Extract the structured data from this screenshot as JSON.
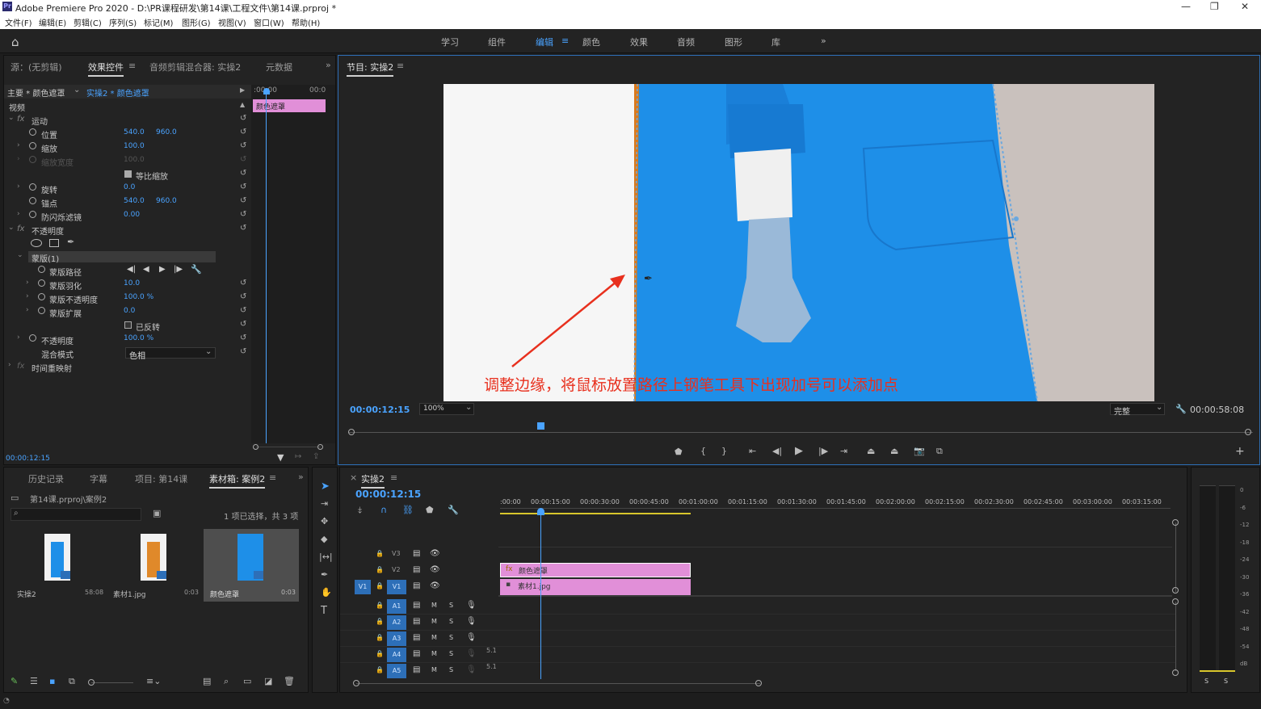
{
  "titlebar": {
    "title": "Adobe Premiere Pro 2020 - D:\\PR课程研发\\第14课\\工程文件\\第14课.prproj *",
    "logo": "Pr"
  },
  "menu": [
    "文件(F)",
    "编辑(E)",
    "剪辑(C)",
    "序列(S)",
    "标记(M)",
    "图形(G)",
    "视图(V)",
    "窗口(W)",
    "帮助(H)"
  ],
  "workspaces": [
    {
      "label": "学习"
    },
    {
      "label": "组件"
    },
    {
      "label": "编辑",
      "active": true
    },
    {
      "label": "颜色"
    },
    {
      "label": "效果"
    },
    {
      "label": "音频"
    },
    {
      "label": "图形"
    },
    {
      "label": "库"
    }
  ],
  "effects_panel": {
    "tabs": [
      "源：(无剪辑)",
      "效果控件",
      "音频剪辑混合器: 实操2",
      "元数据"
    ],
    "header_master": "主要 * 颜色遮罩",
    "header_clip": "实操2 * 颜色遮罩",
    "timecode_start": ":00:00",
    "timecode_end": "00:0",
    "clip_label": "颜色遮罩",
    "section_video": "视频",
    "motion": "运动",
    "position_label": "位置",
    "position_x": "540.0",
    "position_y": "960.0",
    "scale_label": "缩放",
    "scale_value": "100.0",
    "scale_width_label": "缩放宽度",
    "scale_width_value": "100.0",
    "uniform_scale": "等比缩放",
    "rotation_label": "旋转",
    "rotation_value": "0.0",
    "anchor_label": "锚点",
    "anchor_x": "540.0",
    "anchor_y": "960.0",
    "antiflicker_label": "防闪烁滤镜",
    "antiflicker_value": "0.00",
    "opacity_section": "不透明度",
    "mask_label": "蒙版(1)",
    "mask_path_label": "蒙版路径",
    "mask_feather_label": "蒙版羽化",
    "mask_feather_value": "10.0",
    "mask_opacity_label": "蒙版不透明度",
    "mask_opacity_value": "100.0 %",
    "mask_expansion_label": "蒙版扩展",
    "mask_expansion_value": "0.0",
    "inverted_label": "已反转",
    "opacity_label": "不透明度",
    "opacity_value": "100.0 %",
    "blend_label": "混合模式",
    "blend_value": "色相",
    "time_remap": "时间重映射",
    "current_time": "00:00:12:15"
  },
  "program_monitor": {
    "title": "节目: 实操2",
    "annotation": "调整边缘，将鼠标放置路径上钢笔工具下出现加号可以添加点",
    "timecode": "00:00:12:15",
    "zoom": "100%",
    "quality": "完整",
    "duration": "00:00:58:08"
  },
  "project_panel": {
    "tabs": [
      "历史记录",
      "字幕",
      "项目: 第14课",
      "素材箱: 案例2"
    ],
    "path": "第14课.prproj\\案例2",
    "selection": "1 项已选择，共 3 项",
    "items": [
      {
        "name": "实操2",
        "duration": "58:08"
      },
      {
        "name": "素材1.jpg",
        "duration": "0:03"
      },
      {
        "name": "颜色遮罩",
        "duration": "0:03"
      }
    ]
  },
  "timeline": {
    "title": "实操2",
    "timecode": "00:00:12:15",
    "ruler": [
      ":00:00",
      "00:00:15:00",
      "00:00:30:00",
      "00:00:45:00",
      "00:01:00:00",
      "00:01:15:00",
      "00:01:30:00",
      "00:01:45:00",
      "00:02:00:00",
      "00:02:15:00",
      "00:02:30:00",
      "00:02:45:00",
      "00:03:00:00",
      "00:03:15:00"
    ],
    "video_tracks": [
      "V3",
      "V2",
      "V1"
    ],
    "source_patch": "V1",
    "audio_tracks": [
      "A1",
      "A2",
      "A3",
      "A4",
      "A5"
    ],
    "mute": "M",
    "solo": "S",
    "audio_level": "5.1",
    "clip_v2": "颜色遮罩",
    "clip_v1": "素材1.jpg"
  },
  "audio_meter": {
    "scale": [
      "0",
      "-6",
      "-12",
      "-18",
      "-24",
      "-30",
      "-36",
      "-42",
      "-48",
      "-54",
      "dB"
    ],
    "solo_left": "S",
    "solo_right": "S"
  },
  "colors": {
    "accent": "#4aa3ff",
    "clip": "#e18fd8",
    "coat": "#1e8fe8",
    "annotation": "#e8301e"
  }
}
